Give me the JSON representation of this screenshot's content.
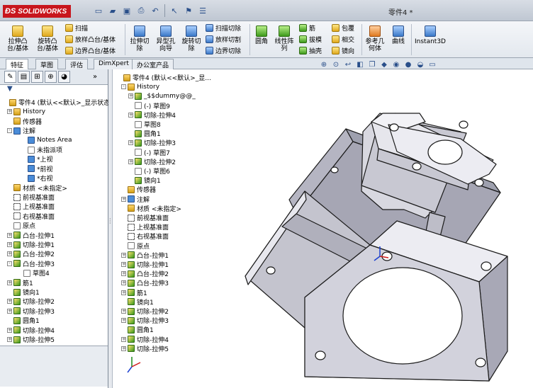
{
  "app": {
    "brand": "SOLIDWORKS",
    "document_title": "零件4 *"
  },
  "command_manager": {
    "big_buttons": [
      {
        "label_1": "拉伸凸",
        "label_2": "台/基体"
      },
      {
        "label_1": "旋转凸",
        "label_2": "台/基体"
      },
      {
        "label_1": "拉伸切",
        "label_2": "除"
      },
      {
        "label_1": "异型孔",
        "label_2": "向导"
      },
      {
        "label_1": "旋转切",
        "label_2": "除"
      },
      {
        "label_1": "圆角",
        "label_2": ""
      },
      {
        "label_1": "线性阵",
        "label_2": "列"
      },
      {
        "label_1": "参考几",
        "label_2": "何体"
      },
      {
        "label_1": "曲线",
        "label_2": ""
      },
      {
        "label_1": "Instant3D",
        "label_2": ""
      }
    ],
    "small_buttons": [
      "扫描",
      "放样凸台/基体",
      "边界凸台/基体",
      "扫描切除",
      "放样切割",
      "边界切除",
      "筋",
      "拔模",
      "抽壳",
      "包覆",
      "相交",
      "镜向"
    ]
  },
  "tabs": [
    "特征",
    "草图",
    "评估",
    "DimXpert",
    "办公室产品"
  ],
  "feature_tree": {
    "root": "零件4 (默认<<默认>_显示状态",
    "items": [
      "History",
      "传感器",
      "注解",
      "Notes Area",
      "未指派项",
      "*上视",
      "*前视",
      "*右视",
      "材质 <未指定>",
      "前视基准面",
      "上视基准面",
      "右视基准面",
      "原点",
      "凸台-拉伸1",
      "切除-拉伸1",
      "凸台-拉伸2",
      "凸台-拉伸3",
      "草图4",
      "筋1",
      "镜向1",
      "切除-拉伸2",
      "切除-拉伸3",
      "圆角1",
      "切除-拉伸4",
      "切除-拉伸5"
    ]
  },
  "flyout_tree": {
    "root": "零件4 (默认<<默认>_显...",
    "items": [
      "History",
      "_$$dummy@@_",
      "(-) 草图9",
      "切除-拉伸4",
      "草图8",
      "圆角1",
      "切除-拉伸3",
      "(-) 草图7",
      "切除-拉伸2",
      "(-) 草图6",
      "镜向1",
      "传感器",
      "注解",
      "材质 <未指定>",
      "前视基准面",
      "上视基准面",
      "右视基准面",
      "原点",
      "凸台-拉伸1",
      "切除-拉伸1",
      "凸台-拉伸2",
      "凸台-拉伸3",
      "筋1",
      "镜向1",
      "切除-拉伸2",
      "切除-拉伸3",
      "圆角1",
      "切除-拉伸4",
      "切除-拉伸5"
    ]
  },
  "icons": {
    "colors": {
      "accent": "#c8161d",
      "feature_green": "#3a9a1b",
      "folder_yellow": "#d4a017",
      "part_gray": "#a6a6b4"
    }
  }
}
